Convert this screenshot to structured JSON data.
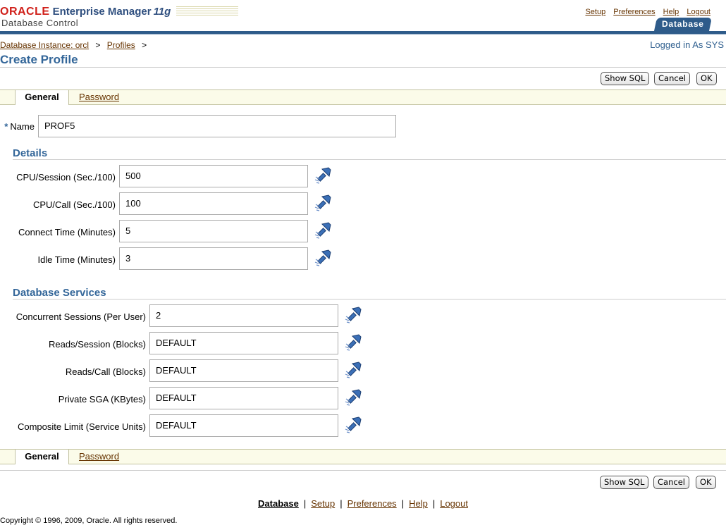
{
  "header": {
    "brand_oracle": "ORACLE",
    "brand_product": "Enterprise Manager",
    "brand_version": "11g",
    "brand_subtitle": "Database Control",
    "global_links": [
      "Setup",
      "Preferences",
      "Help",
      "Logout"
    ],
    "target_tab": "Database"
  },
  "breadcrumb": {
    "items": [
      "Database Instance: orcl",
      "Profiles"
    ],
    "separator": ">"
  },
  "logged_in": "Logged in As SYS",
  "page_title": "Create Profile",
  "buttons": {
    "show_sql": "Show SQL",
    "cancel": "Cancel",
    "ok": "OK"
  },
  "subtabs": {
    "general": "General",
    "password": "Password"
  },
  "form": {
    "name_label": "Name",
    "name_value": "PROF5",
    "details_title": "Details",
    "details": [
      {
        "label": "CPU/Session (Sec./100)",
        "value": "500"
      },
      {
        "label": "CPU/Call (Sec./100)",
        "value": "100"
      },
      {
        "label": "Connect Time (Minutes)",
        "value": "5"
      },
      {
        "label": "Idle Time (Minutes)",
        "value": "3"
      }
    ],
    "services_title": "Database Services",
    "services": [
      {
        "label": "Concurrent Sessions (Per User)",
        "value": "2"
      },
      {
        "label": "Reads/Session (Blocks)",
        "value": "DEFAULT"
      },
      {
        "label": "Reads/Call (Blocks)",
        "value": "DEFAULT"
      },
      {
        "label": "Private SGA (KBytes)",
        "value": "DEFAULT"
      },
      {
        "label": "Composite Limit (Service Units)",
        "value": "DEFAULT"
      }
    ],
    "lov_icon": "flashlight-search-icon"
  },
  "footer": {
    "links": [
      "Database",
      "Setup",
      "Preferences",
      "Help",
      "Logout"
    ],
    "copyright": "Copyright © 1996, 2009, Oracle. All rights reserved."
  },
  "colors": {
    "brand_blue": "#2e5b8a",
    "section_blue": "#336699",
    "link_brown": "#663300"
  }
}
